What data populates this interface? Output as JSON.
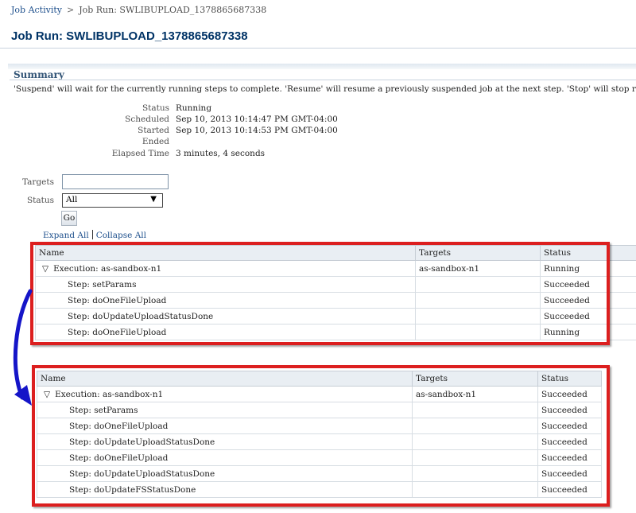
{
  "breadcrumb": {
    "root": "Job Activity",
    "separator": ">",
    "current": "Job Run: SWLIBUPLOAD_1378865687338"
  },
  "page_title": "Job Run: SWLIBUPLOAD_1378865687338",
  "summary": {
    "heading": "Summary",
    "note": "'Suspend' will wait for the currently running steps to complete. 'Resume' will resume a previously suspended job at the next step. 'Stop' will stop running steps if it can.",
    "fields": [
      {
        "label": "Status",
        "value": "Running"
      },
      {
        "label": "Scheduled",
        "value": "Sep 10, 2013 10:14:47 PM GMT-04:00"
      },
      {
        "label": "Started",
        "value": "Sep 10, 2013 10:14:53 PM GMT-04:00"
      },
      {
        "label": "Ended",
        "value": ""
      },
      {
        "label": "Elapsed Time",
        "value": "3 minutes, 4 seconds"
      }
    ]
  },
  "filter": {
    "targets_label": "Targets",
    "targets_value": "",
    "status_label": "Status",
    "status_value": "All",
    "go_label": "Go"
  },
  "links": {
    "expand_all": "Expand All",
    "collapse_all": "Collapse All"
  },
  "columns": {
    "name": "Name",
    "targets": "Targets",
    "status": "Status"
  },
  "table_before": {
    "rows": [
      {
        "name": "Execution: as-sandbox-n1",
        "targets": "as-sandbox-n1",
        "status": "Running",
        "kind": "exec"
      },
      {
        "name": "Step: setParams",
        "targets": "",
        "status": "Succeeded",
        "kind": "step"
      },
      {
        "name": "Step: doOneFileUpload",
        "targets": "",
        "status": "Succeeded",
        "kind": "step"
      },
      {
        "name": "Step: doUpdateUploadStatusDone",
        "targets": "",
        "status": "Succeeded",
        "kind": "step"
      },
      {
        "name": "Step: doOneFileUpload",
        "targets": "",
        "status": "Running",
        "kind": "step"
      }
    ]
  },
  "table_after": {
    "rows": [
      {
        "name": "Execution: as-sandbox-n1",
        "targets": "as-sandbox-n1",
        "status": "Succeeded",
        "kind": "exec"
      },
      {
        "name": "Step: setParams",
        "targets": "",
        "status": "Succeeded",
        "kind": "step"
      },
      {
        "name": "Step: doOneFileUpload",
        "targets": "",
        "status": "Succeeded",
        "kind": "step"
      },
      {
        "name": "Step: doUpdateUploadStatusDone",
        "targets": "",
        "status": "Succeeded",
        "kind": "step"
      },
      {
        "name": "Step: doOneFileUpload",
        "targets": "",
        "status": "Succeeded",
        "kind": "step"
      },
      {
        "name": "Step: doUpdateUploadStatusDone",
        "targets": "",
        "status": "Succeeded",
        "kind": "step"
      },
      {
        "name": "Step: doUpdateFSStatusDone",
        "targets": "",
        "status": "Succeeded",
        "kind": "step"
      }
    ]
  },
  "icons": {
    "expand_triangle": "▽",
    "select_arrow": "▼"
  },
  "colors": {
    "link": "#1d4f8c",
    "title": "#003366",
    "annotation_box": "#dc1f1f",
    "annotation_arrow": "#1515c8"
  }
}
